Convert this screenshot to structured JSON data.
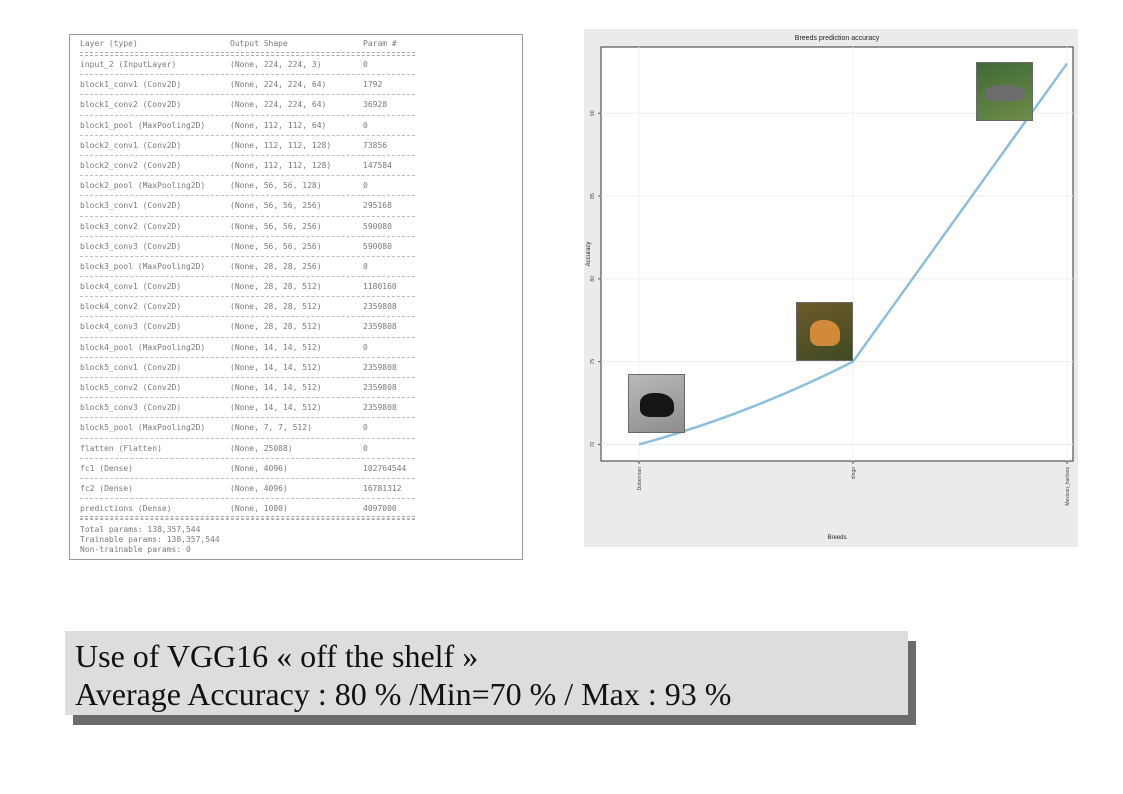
{
  "summary": {
    "headers": [
      "Layer (type)",
      "Output Shape",
      "Param #"
    ],
    "rows": [
      [
        "input_2 (InputLayer)",
        "(None, 224, 224, 3)",
        "0"
      ],
      [
        "block1_conv1 (Conv2D)",
        "(None, 224, 224, 64)",
        "1792"
      ],
      [
        "block1_conv2 (Conv2D)",
        "(None, 224, 224, 64)",
        "36928"
      ],
      [
        "block1_pool (MaxPooling2D)",
        "(None, 112, 112, 64)",
        "0"
      ],
      [
        "block2_conv1 (Conv2D)",
        "(None, 112, 112, 128)",
        "73856"
      ],
      [
        "block2_conv2 (Conv2D)",
        "(None, 112, 112, 128)",
        "147584"
      ],
      [
        "block2_pool (MaxPooling2D)",
        "(None, 56, 56, 128)",
        "0"
      ],
      [
        "block3_conv1 (Conv2D)",
        "(None, 56, 56, 256)",
        "295168"
      ],
      [
        "block3_conv2 (Conv2D)",
        "(None, 56, 56, 256)",
        "590080"
      ],
      [
        "block3_conv3 (Conv2D)",
        "(None, 56, 56, 256)",
        "590080"
      ],
      [
        "block3_pool (MaxPooling2D)",
        "(None, 28, 28, 256)",
        "0"
      ],
      [
        "block4_conv1 (Conv2D)",
        "(None, 28, 28, 512)",
        "1180160"
      ],
      [
        "block4_conv2 (Conv2D)",
        "(None, 28, 28, 512)",
        "2359808"
      ],
      [
        "block4_conv3 (Conv2D)",
        "(None, 28, 28, 512)",
        "2359808"
      ],
      [
        "block4_pool (MaxPooling2D)",
        "(None, 14, 14, 512)",
        "0"
      ],
      [
        "block5_conv1 (Conv2D)",
        "(None, 14, 14, 512)",
        "2359808"
      ],
      [
        "block5_conv2 (Conv2D)",
        "(None, 14, 14, 512)",
        "2359808"
      ],
      [
        "block5_conv3 (Conv2D)",
        "(None, 14, 14, 512)",
        "2359808"
      ],
      [
        "block5_pool (MaxPooling2D)",
        "(None, 7, 7, 512)",
        "0"
      ],
      [
        "flatten (Flatten)",
        "(None, 25088)",
        "0"
      ],
      [
        "fc1 (Dense)",
        "(None, 4096)",
        "102764544"
      ],
      [
        "fc2 (Dense)",
        "(None, 4096)",
        "16781312"
      ],
      [
        "predictions (Dense)",
        "(None, 1000)",
        "4097000"
      ]
    ],
    "total_params": "Total params: 138,357,544",
    "trainable_params": "Trainable params: 138,357,544",
    "non_trainable_params": "Non-trainable params: 0"
  },
  "chart_data": {
    "type": "line",
    "title": "Breeds prediction accuracy",
    "xlabel": "Breeds",
    "ylabel": "Accuracy",
    "categories": [
      "Doberman",
      "dingo",
      "Mexican_hairless"
    ],
    "values": [
      70,
      75,
      93
    ],
    "ylim": [
      69,
      94
    ],
    "yticks": [
      70,
      75,
      80,
      85,
      90
    ],
    "grid": true,
    "legend": "none",
    "colors": {
      "line": "#8cbfde",
      "panel_bg": "#ebebeb",
      "plot_bg": "#ffffff"
    },
    "point_images": [
      "black-dog-photo",
      "tan-dog-photo",
      "grey-dog-photo"
    ]
  },
  "caption": {
    "line1": "Use of VGG16 « off the shelf »",
    "line2": "Average Accuracy : 80 % /Min=70 % / Max : 93 %"
  }
}
